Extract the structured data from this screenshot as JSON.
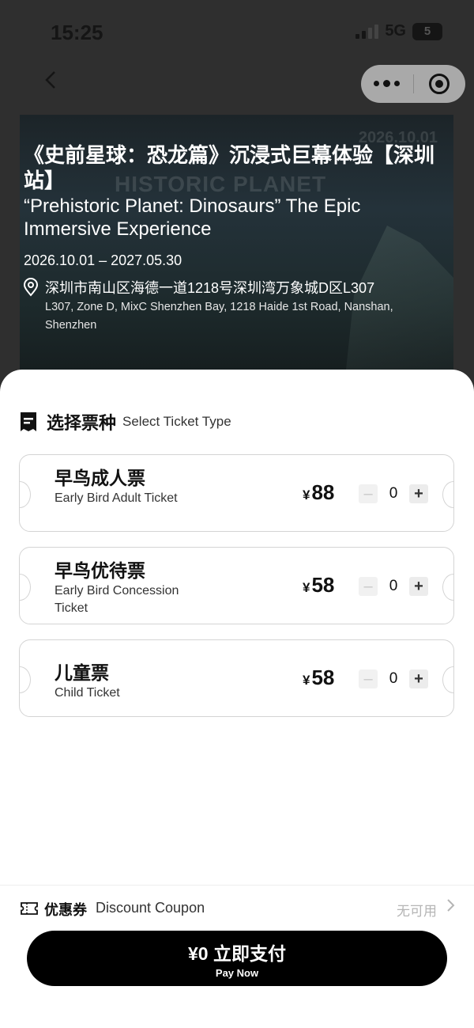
{
  "status_bar": {
    "time": "15:25",
    "network": "5G",
    "battery": "5"
  },
  "hero": {
    "bg_text": "HISTORIC PLANET",
    "bg_date": "2026.10.01",
    "title": "《史前星球：恐龙篇》沉浸式巨幕体验【深圳站】",
    "subtitle": "“Prehistoric Planet: Dinosaurs” The Epic Immersive Experience",
    "date_range": "2026.10.01 – 2027.05.30",
    "location_cn": "深圳市南山区海德一道1218号深圳湾万象城D区L307",
    "location_en": "L307, Zone D, MixC Shenzhen Bay, 1218 Haide 1st Road, Nanshan, Shenzhen"
  },
  "ticket_section": {
    "title_cn": "选择票种",
    "title_en": "Select Ticket Type",
    "currency": "¥",
    "tickets": [
      {
        "name_cn": "早鸟成人票",
        "name_en": "Early Bird Adult Ticket",
        "price": "88",
        "qty": "0"
      },
      {
        "name_cn": "早鸟优待票",
        "name_en": "Early Bird Concession Ticket",
        "price": "58",
        "qty": "0"
      },
      {
        "name_cn": "儿童票",
        "name_en": "Child Ticket",
        "price": "58",
        "qty": "0"
      }
    ]
  },
  "coupon": {
    "label_cn": "优惠券",
    "label_en": "Discount Coupon",
    "status": "无可用"
  },
  "pay": {
    "main": "¥0 立即支付",
    "sub": "Pay Now"
  },
  "icons": [
    "back-icon",
    "more-icon",
    "target-icon",
    "location-pin-icon",
    "ticket-icon",
    "coupon-icon",
    "chevron-right-icon",
    "minus-icon",
    "plus-icon"
  ]
}
